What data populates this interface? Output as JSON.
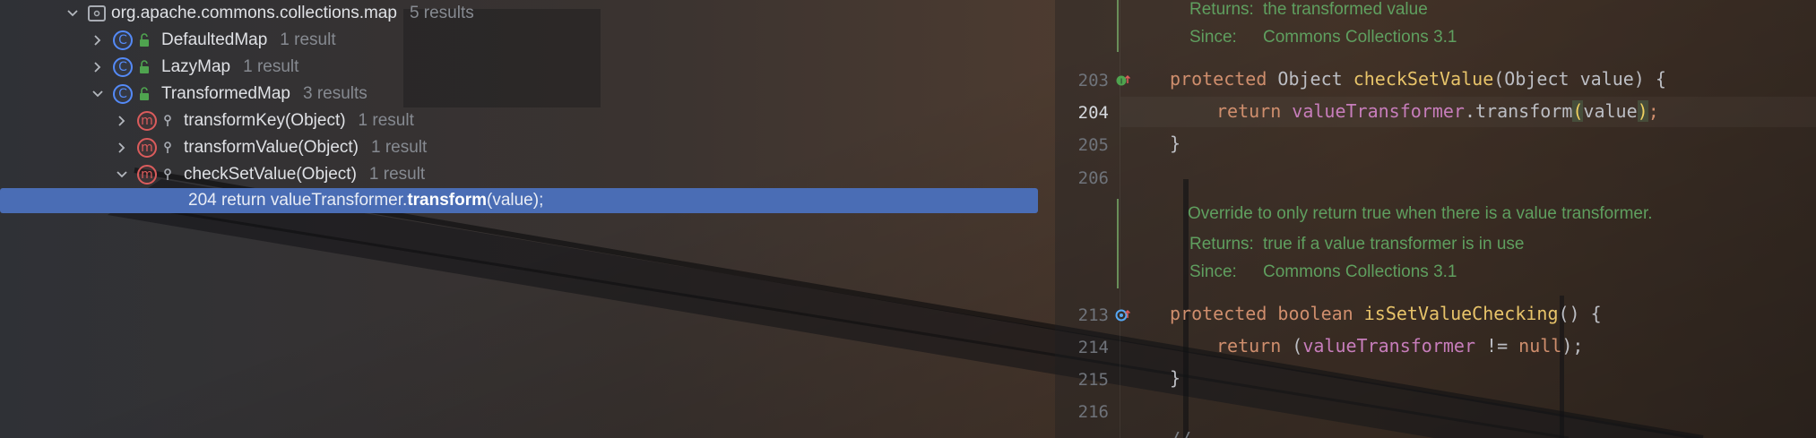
{
  "tree": {
    "package": {
      "name": "org.apache.commons.collections.map",
      "count": "5 results"
    },
    "classes": [
      {
        "name": "DefaultedMap",
        "count": "1 result"
      },
      {
        "name": "LazyMap",
        "count": "1 result"
      },
      {
        "name": "TransformedMap",
        "count": "3 results"
      }
    ],
    "methods": [
      {
        "name": "transformKey(Object)",
        "count": "1 result"
      },
      {
        "name": "transformValue(Object)",
        "count": "1 result"
      },
      {
        "name": "checkSetValue(Object)",
        "count": "1 result"
      }
    ],
    "selected_usage": {
      "prefix": "204 return valueTransformer.",
      "match": "transform",
      "suffix": "(value);"
    }
  },
  "editor": {
    "doc1": {
      "returns_label": "Returns:",
      "returns_text": "the transformed value",
      "since_label": "Since:",
      "since_text": "Commons Collections 3.1"
    },
    "doc2": {
      "summary": "Override to only return true when there is a value transformer.",
      "returns_label": "Returns:",
      "returns_text": "true if a value transformer is in use",
      "since_label": "Since:",
      "since_text": "Commons Collections 3.1"
    },
    "line_numbers": [
      "203",
      "204",
      "205",
      "206",
      "213",
      "214",
      "215",
      "216"
    ],
    "code": {
      "l203": {
        "kw": "protected",
        "type": " Object ",
        "fn": "checkSetValue",
        "rest": "(Object value) {"
      },
      "l204": {
        "kw": "return ",
        "field": "valueTransformer",
        "dot": ".",
        "call": "transform",
        "open": "(",
        "arg": "value",
        "close": ")",
        "semi": ";"
      },
      "l205": "}",
      "l213": {
        "kw": "protected",
        "kw2": " boolean ",
        "fn": "isSetValueChecking",
        "rest": "() {"
      },
      "l214": {
        "kw": "return ",
        "open": "(",
        "field": "valueTransformer",
        "op": " != ",
        "null": "null",
        "close": ");"
      },
      "l215": "}",
      "l217": "//"
    }
  },
  "colors": {
    "selection": "#4a6db5",
    "keyword": "#cf8e6d",
    "function": "#56a8f5",
    "field": "#c77dbb",
    "doc": "#5f9f5f"
  }
}
